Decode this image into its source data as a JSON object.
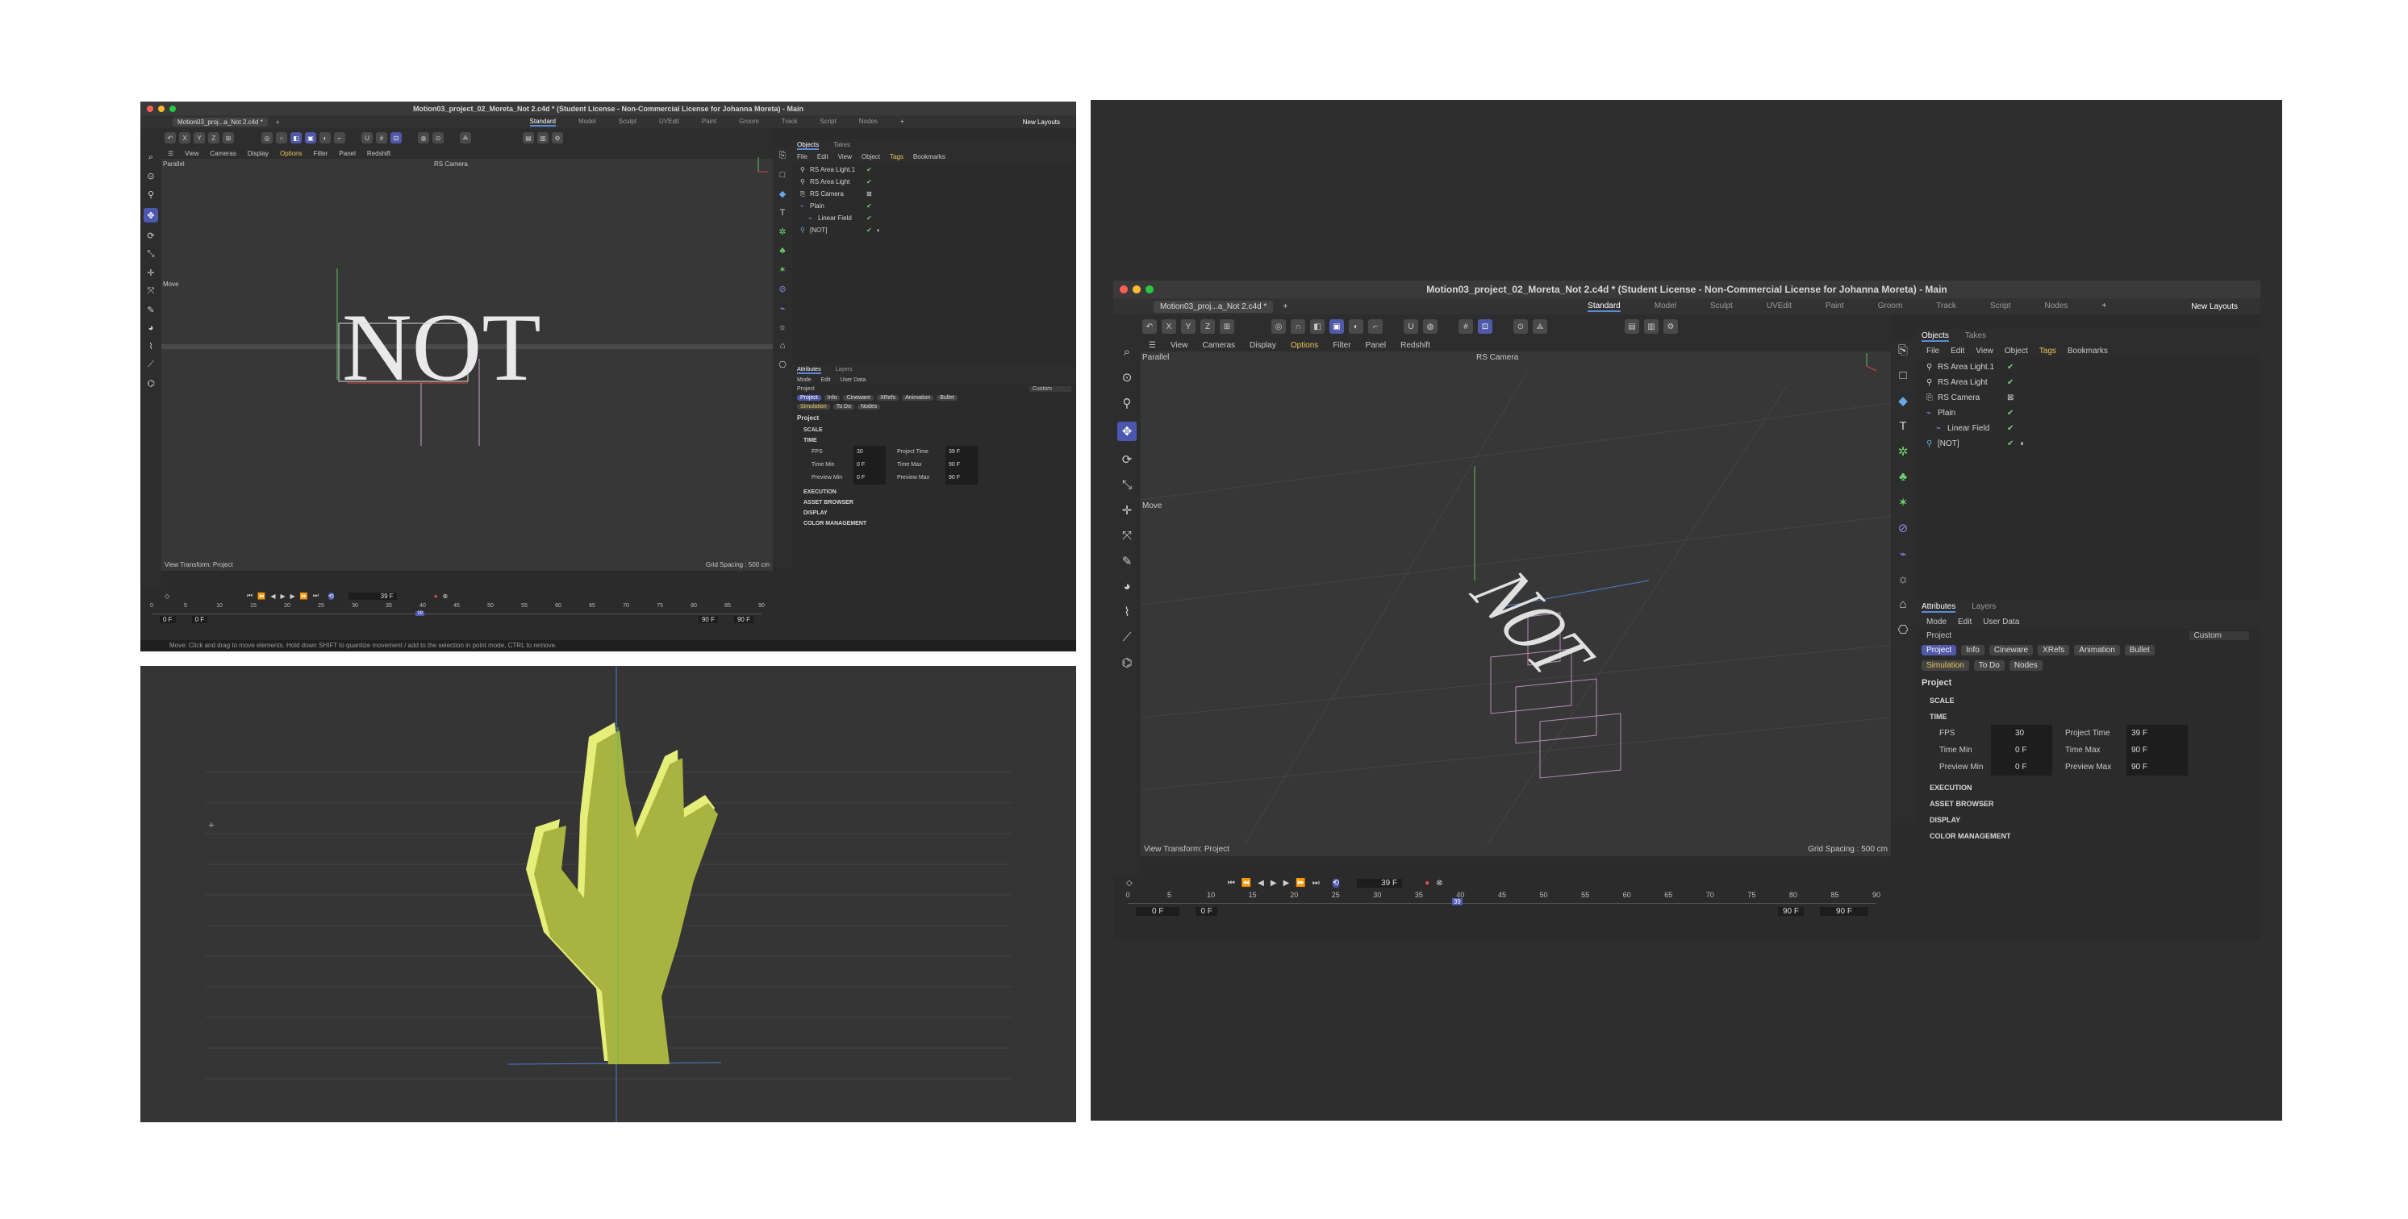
{
  "window": {
    "title": "Motion03_project_02_Moreta_Not 2.c4d * (Student License - Non-Commercial License for Johanna Moreta) - Main",
    "doc_tab": "Motion03_proj...a_Not 2.c4d *",
    "new_tab": "+"
  },
  "layouts": [
    "Standard",
    "Model",
    "Sculpt",
    "UVEdit",
    "Paint",
    "Groom",
    "Track",
    "Script",
    "Nodes"
  ],
  "layouts_add": "+",
  "new_layouts": "New Layouts",
  "toolbar": {
    "x": "X",
    "y": "Y",
    "z": "Z"
  },
  "viewport": {
    "menu": [
      "View",
      "Cameras",
      "Display",
      "Options",
      "Filter",
      "Panel",
      "Redshift"
    ],
    "projection": "Parallel",
    "camera": "RS Camera",
    "move_label": "Move",
    "view_transform": "View Transform: Project",
    "grid_spacing_small": "Grid Spacing : 500 cm",
    "grid_spacing_large": "Grid Spacing : 500 cm",
    "scene_text": "NOT"
  },
  "objects_panel": {
    "tabs": [
      "Objects",
      "Takes"
    ],
    "menu": [
      "File",
      "Edit",
      "View",
      "Object",
      "Tags",
      "Bookmarks"
    ],
    "items": [
      {
        "name": "RS Area Light.1",
        "indent": 0
      },
      {
        "name": "RS Area Light",
        "indent": 0
      },
      {
        "name": "RS Camera",
        "indent": 0
      },
      {
        "name": "Plain",
        "indent": 0
      },
      {
        "name": "Linear Field",
        "indent": 1
      },
      {
        "name": "[NOT]",
        "indent": 0
      }
    ]
  },
  "attributes_panel": {
    "tabs": [
      "Attributes",
      "Layers"
    ],
    "menu": [
      "Mode",
      "Edit",
      "User Data"
    ],
    "object": "Project",
    "preset": "Custom",
    "chips_row1": [
      "Project",
      "Info",
      "Cineware",
      "XRefs",
      "Animation",
      "Bullet"
    ],
    "chips_row2": [
      "Simulation",
      "To Do",
      "Nodes"
    ],
    "heading": "Project",
    "sections": {
      "scale": "SCALE",
      "time": "TIME",
      "execution": "EXECUTION",
      "asset_browser": "ASSET BROWSER",
      "display": "DISPLAY",
      "color_management": "COLOR MANAGEMENT"
    },
    "fields": {
      "fps_label": "FPS",
      "fps": "30",
      "project_time_label": "Project Time",
      "project_time": "39 F",
      "time_min_label": "Time Min",
      "time_min": "0 F",
      "time_max_label": "Time Max",
      "time_max": "90 F",
      "preview_min_label": "Preview Min",
      "preview_min": "0 F",
      "preview_max_label": "Preview Max",
      "preview_max": "90 F"
    }
  },
  "timeline": {
    "current_frame": "39 F",
    "ticks": [
      "0",
      "5",
      "10",
      "15",
      "20",
      "25",
      "30",
      "35",
      "40",
      "45",
      "50",
      "55",
      "60",
      "65",
      "70",
      "75",
      "80",
      "85",
      "90"
    ],
    "playhead_label": "39",
    "start_a": "0 F",
    "start_b": "0 F",
    "end_a": "90 F",
    "end_b": "90 F",
    "playhead_fraction": 0.433
  },
  "status_text": "Move: Click and drag to move elements. Hold down SHIFT to quantize movement / add to the selection in point mode, CTRL to remove.",
  "colors": {
    "accent": "#5059a8",
    "tag_yellow": "#e8c35a",
    "check_green": "#6fd16f",
    "hand": "#b9c34a",
    "hand_highlight": "#e6ee7a"
  }
}
